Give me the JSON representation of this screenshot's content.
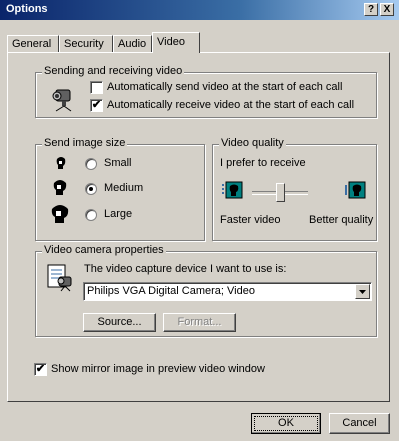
{
  "window": {
    "title": "Options",
    "help_btn": "?",
    "close_btn": "X"
  },
  "tabs": [
    {
      "label": "General"
    },
    {
      "label": "Security"
    },
    {
      "label": "Audio"
    },
    {
      "label": "Video"
    }
  ],
  "sending": {
    "group_label": "Sending and receiving video",
    "auto_send_label": "Automatically send video at the start of each call",
    "auto_send_checked": false,
    "auto_receive_label": "Automatically receive video at the start of each call",
    "auto_receive_checked": true
  },
  "image_size": {
    "group_label": "Send image size",
    "options": [
      {
        "label": "Small",
        "selected": false
      },
      {
        "label": "Medium",
        "selected": true
      },
      {
        "label": "Large",
        "selected": false
      }
    ]
  },
  "quality": {
    "group_label": "Video quality",
    "prefer_text": "I prefer to receive",
    "faster_label": "Faster video",
    "better_label": "Better quality",
    "slider_value": 0.5
  },
  "camera": {
    "group_label": "Video camera properties",
    "device_label": "The video capture device I want to use is:",
    "device_value": "Philips VGA Digital Camera; Video",
    "source_button": "Source...",
    "format_button": "Format..."
  },
  "mirror": {
    "label": "Show mirror image in preview video window",
    "checked": true
  },
  "footer": {
    "ok_button": "OK",
    "cancel_button": "Cancel"
  }
}
